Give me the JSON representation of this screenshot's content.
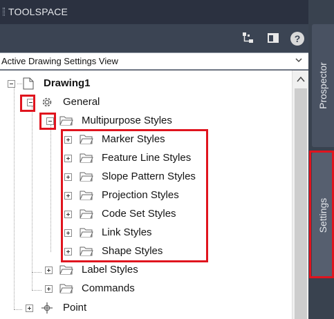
{
  "window": {
    "title": "TOOLSPACE"
  },
  "toolbar": {
    "buttons": [
      {
        "name": "toolspace-tree-icon"
      },
      {
        "name": "panel-layout-icon"
      },
      {
        "name": "help-icon",
        "glyph": "?"
      }
    ]
  },
  "view_selector": {
    "value": "Active Drawing Settings View"
  },
  "tree": {
    "root": {
      "label": "Drawing1"
    },
    "general": {
      "label": "General"
    },
    "multipurpose": {
      "label": "Multipurpose Styles"
    },
    "multipurpose_children": [
      {
        "label": "Marker Styles"
      },
      {
        "label": "Feature Line Styles"
      },
      {
        "label": "Slope Pattern Styles"
      },
      {
        "label": "Projection Styles"
      },
      {
        "label": "Code Set Styles"
      },
      {
        "label": "Link Styles"
      },
      {
        "label": "Shape Styles"
      }
    ],
    "general_children": [
      {
        "label": "Label Styles"
      },
      {
        "label": "Commands"
      }
    ],
    "point": {
      "label": "Point"
    }
  },
  "side_tabs": [
    {
      "label": "Prospector",
      "active": false
    },
    {
      "label": "Settings",
      "active": true
    }
  ],
  "colors": {
    "highlight": "#e0141e",
    "panel": "#3b4453",
    "tree_background": "#ffffff"
  }
}
